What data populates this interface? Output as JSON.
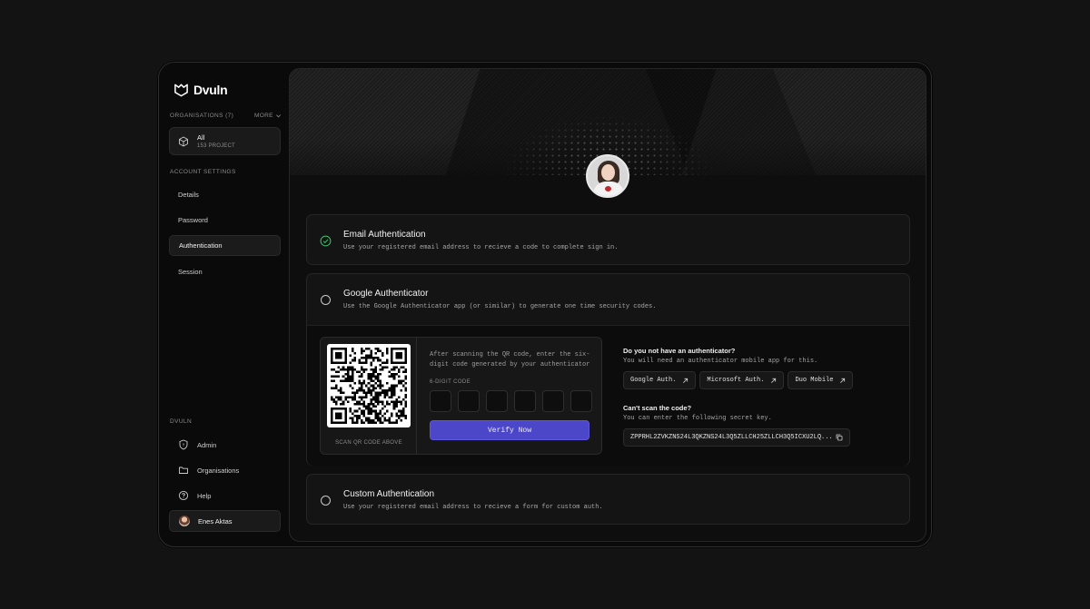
{
  "brand": {
    "name": "Dvuln"
  },
  "sidebar": {
    "organisations_label": "ORGANISATIONS (7)",
    "more_label": "MORE",
    "org_card": {
      "title": "All",
      "subtitle": "153 PROJECT"
    },
    "account_settings_label": "ACCOUNT SETTINGS",
    "account_items": [
      {
        "label": "Details"
      },
      {
        "label": "Password"
      },
      {
        "label": "Authentication",
        "active": true
      },
      {
        "label": "Session"
      }
    ],
    "dvuln_label": "DVULN",
    "dvuln_items": [
      {
        "label": "Admin",
        "icon": "shield-icon"
      },
      {
        "label": "Organisations",
        "icon": "folder-icon"
      },
      {
        "label": "Help",
        "icon": "help-circle-icon"
      }
    ],
    "user": {
      "name": "Enes Aktas"
    }
  },
  "auth": {
    "email": {
      "title": "Email Authentication",
      "description": "Use your registered email address to recieve a code to complete sign in.",
      "selected": true
    },
    "google": {
      "title": "Google Authenticator",
      "description": "Use the Google Authenticator app (or similar) to generate one time security codes.",
      "qr_caption": "SCAN QR CODE ABOVE",
      "instructions": "After scanning the QR code, enter the six-digit code generated by your authenticator",
      "code_label": "6-DIGIT CODE",
      "code_digits": [
        "",
        "",
        "",
        "",
        "",
        ""
      ],
      "verify_label": "Verify Now",
      "no_app_title": "Do you not have an authenticator?",
      "no_app_desc": "You will need an authenticator mobile app for this.",
      "apps": [
        "Google Auth.",
        "Microsoft Auth.",
        "Duo Mobile"
      ],
      "cant_scan_title": "Can't scan the code?",
      "cant_scan_desc": "You can enter the following secret key.",
      "secret_key": "ZPPRHL2ZVKZNS24L3QKZNS24L3Q5ZLLCH25ZLLCH3Q5ICXU2LQ..."
    },
    "custom": {
      "title": "Custom Authentication",
      "description": "Use your registered email address to recieve a form for custom auth."
    }
  },
  "colors": {
    "accent": "#4c47c8",
    "success": "#3fbf6f",
    "background": "#131313"
  }
}
